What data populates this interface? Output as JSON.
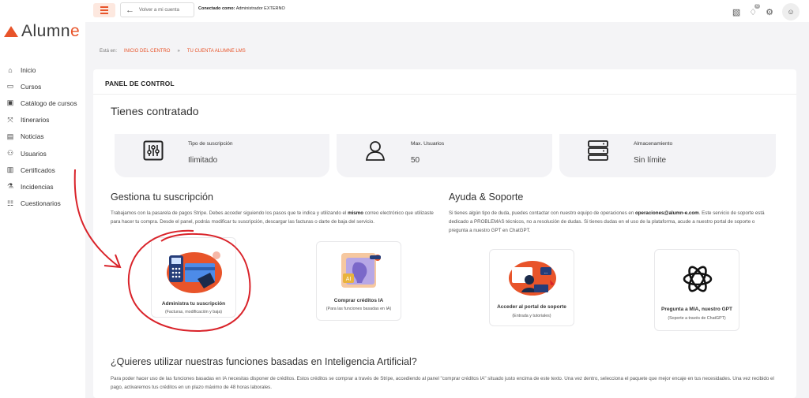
{
  "app": {
    "logo_text_main": "Alumn",
    "logo_text_accent": "e"
  },
  "sidebar": {
    "items": [
      {
        "label": "Inicio",
        "icon": "home-icon",
        "glyph": "⌂"
      },
      {
        "label": "Cursos",
        "icon": "book-icon",
        "glyph": "▭"
      },
      {
        "label": "Catálogo de cursos",
        "icon": "catalog-icon",
        "glyph": "▣"
      },
      {
        "label": "Itinerarios",
        "icon": "signpost-icon",
        "glyph": "⤧"
      },
      {
        "label": "Noticias",
        "icon": "news-icon",
        "glyph": "▤"
      },
      {
        "label": "Usuarios",
        "icon": "users-icon",
        "glyph": "⚇"
      },
      {
        "label": "Certificados",
        "icon": "certificate-icon",
        "glyph": "▥"
      },
      {
        "label": "Incidencias",
        "icon": "flask-icon",
        "glyph": "⚗"
      },
      {
        "label": "Cuestionarios",
        "icon": "quiz-icon",
        "glyph": "☷"
      }
    ]
  },
  "topbar": {
    "back_label": "Volver a mi cuenta",
    "connected_prefix": "Conectado como:",
    "connected_user": "Administrador EXTERNO",
    "notification_count": "0"
  },
  "breadcrumb": {
    "prefix": "Está en:",
    "items": [
      "INICIO DEL CENTRO",
      "»",
      "TU CUENTA ALUMNE LMS"
    ]
  },
  "panel": {
    "title": "PANEL DE CONTROL",
    "contracted_heading": "Tienes contratado",
    "stats": [
      {
        "label": "Tipo de suscripción",
        "value": "Ilimitado",
        "icon": "sliders-icon"
      },
      {
        "label": "Max. Usuarios",
        "value": "50",
        "icon": "user-icon"
      },
      {
        "label": "Almacenamiento",
        "value": "Sin límite",
        "icon": "server-icon"
      }
    ],
    "manage": {
      "heading": "Gestiona tu suscripción",
      "text_1": "Trabajamos con la pasarela de pagos Stripe. Debes acceder siguiendo los pasos que te indica y utilizando el",
      "text_bold": "mismo",
      "text_2": "correo electrónico que utilizaste para hacer tu compra. Desde el panel, podrás modificar tu suscripción, descargar las facturas o darte de baja del servicio."
    },
    "support": {
      "heading": "Ayuda & Soporte",
      "text_1": "Si tienes algún tipo de duda, puedes contactar con nuestro equipo de operaciones en",
      "email": "operaciones@alumn-e.com",
      "text_2": ". Este servicio de soporte está dedicado a PROBLEMAS técnicos, no a resolución de dudas. Si tienes dudas en el uso de la plataforma, acude a nuestro portal de soporte o pregunta a nuestro GPT en ChatGPT."
    },
    "tiles": [
      {
        "title": "Administra tu suscripción",
        "subtitle": "(Facturas, modificación y baja)"
      },
      {
        "title": "Comprar créditos IA",
        "subtitle": "(Para las funciones basadas en IA)"
      },
      {
        "title": "Acceder al portal de soporte",
        "subtitle": "(Entrada y tutoriales)"
      },
      {
        "title": "Pregunta a MIA, nuestro GPT",
        "subtitle": "(Soporte a través de ChatGPT)"
      }
    ],
    "ai": {
      "heading": "¿Quieres utilizar nuestras funciones basadas en Inteligencia Artificial?",
      "text": "Para poder hacer uso de las funciones basadas en IA necesitas disponer de créditos. Estos créditos se comprar a través de Stripe, accediendo al panel \"comprar créditos IA\" situado justo encima de este texto. Una vez dentro, selecciona el paquete que mejor encaje en tus necesidades. Una vez recibido el pago, activaremos tus créditos en un plazo máximo de 48 horas laborales."
    }
  },
  "colors": {
    "accent": "#e8542a",
    "annotation": "#d9232a",
    "card_bg": "#f3f3f6"
  }
}
